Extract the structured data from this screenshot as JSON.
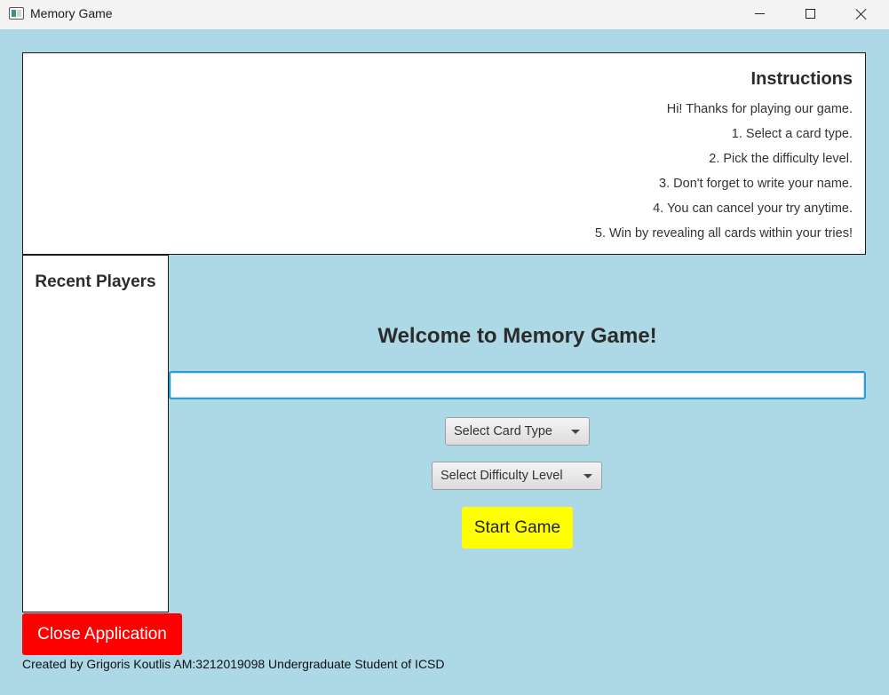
{
  "window": {
    "title": "Memory Game",
    "controls": {
      "minimize": "minimize-icon",
      "maximize": "maximize-icon",
      "close": "close-icon"
    }
  },
  "colors": {
    "background": "#add8e6",
    "start_button": "#ffff00",
    "close_button": "#ff0000",
    "input_focus": "#2d9bd6"
  },
  "instructions": {
    "title": "Instructions",
    "lines": [
      "Hi! Thanks for playing our game.",
      "1. Select a card type.",
      "2. Pick the difficulty level.",
      "3. Don't forget to write your name.",
      "4. You can cancel your try anytime.",
      "5. Win by revealing all cards within your tries!"
    ]
  },
  "recent_players": {
    "title": "Recent Players",
    "items": []
  },
  "main": {
    "welcome": "Welcome to Memory Game!",
    "name_input": {
      "value": "",
      "placeholder": ""
    },
    "card_type_select": {
      "selected": "Select Card Type"
    },
    "difficulty_select": {
      "selected": "Select Difficulty Level"
    },
    "start_button": "Start Game"
  },
  "footer": {
    "close_button": "Close Application",
    "credits": "Created by Grigoris Koutlis AM:3212019098 Undergraduate Student of ICSD"
  }
}
